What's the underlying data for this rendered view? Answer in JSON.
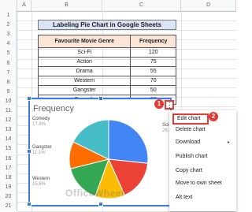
{
  "columns": [
    "A",
    "B",
    "C",
    "D"
  ],
  "rows": [
    "1",
    "2",
    "3",
    "4",
    "5",
    "6",
    "7",
    "8",
    "9",
    "10",
    "11",
    "12",
    "13",
    "14",
    "15",
    "16",
    "17",
    "18",
    "19",
    "20",
    "21"
  ],
  "title": "Labeling Pie Chart in Google Sheets",
  "table": {
    "headers": [
      "Favourite Movie Genre",
      "Frequency"
    ],
    "rows": [
      {
        "genre": "Sci-Fi",
        "frequency": "120"
      },
      {
        "genre": "Action",
        "frequency": "75"
      },
      {
        "genre": "Drama",
        "frequency": "55"
      },
      {
        "genre": "Western",
        "frequency": "70"
      },
      {
        "genre": "Gangster",
        "frequency": "50"
      },
      {
        "genre": "Comedy",
        "frequency": "80"
      }
    ]
  },
  "chart": {
    "title": "Frequency",
    "labels": {
      "comedy": {
        "name": "Comedy",
        "pct": "17.8%"
      },
      "gangster": {
        "name": "Gangster",
        "pct": "11.1%"
      },
      "western": {
        "name": "Western",
        "pct": "15.6%"
      },
      "scifi": {
        "name": "Sci-",
        "pct": "26.7"
      }
    },
    "watermark": "OfficeWheel"
  },
  "chart_data": {
    "type": "pie",
    "title": "Frequency",
    "categories": [
      "Sci-Fi",
      "Action",
      "Drama",
      "Western",
      "Gangster",
      "Comedy"
    ],
    "values": [
      120,
      75,
      55,
      70,
      50,
      80
    ],
    "colors": [
      "#4285f4",
      "#ea4335",
      "#fbbc04",
      "#34a853",
      "#ff6d01",
      "#46bdc6"
    ]
  },
  "more_button": "⋮",
  "badges": [
    "1",
    "2"
  ],
  "menu": {
    "items": [
      "Edit chart",
      "Delete chart",
      "Download",
      "Publish chart",
      "Copy chart",
      "Move to own sheet",
      "Alt text"
    ],
    "submenu_arrow": "▸"
  }
}
